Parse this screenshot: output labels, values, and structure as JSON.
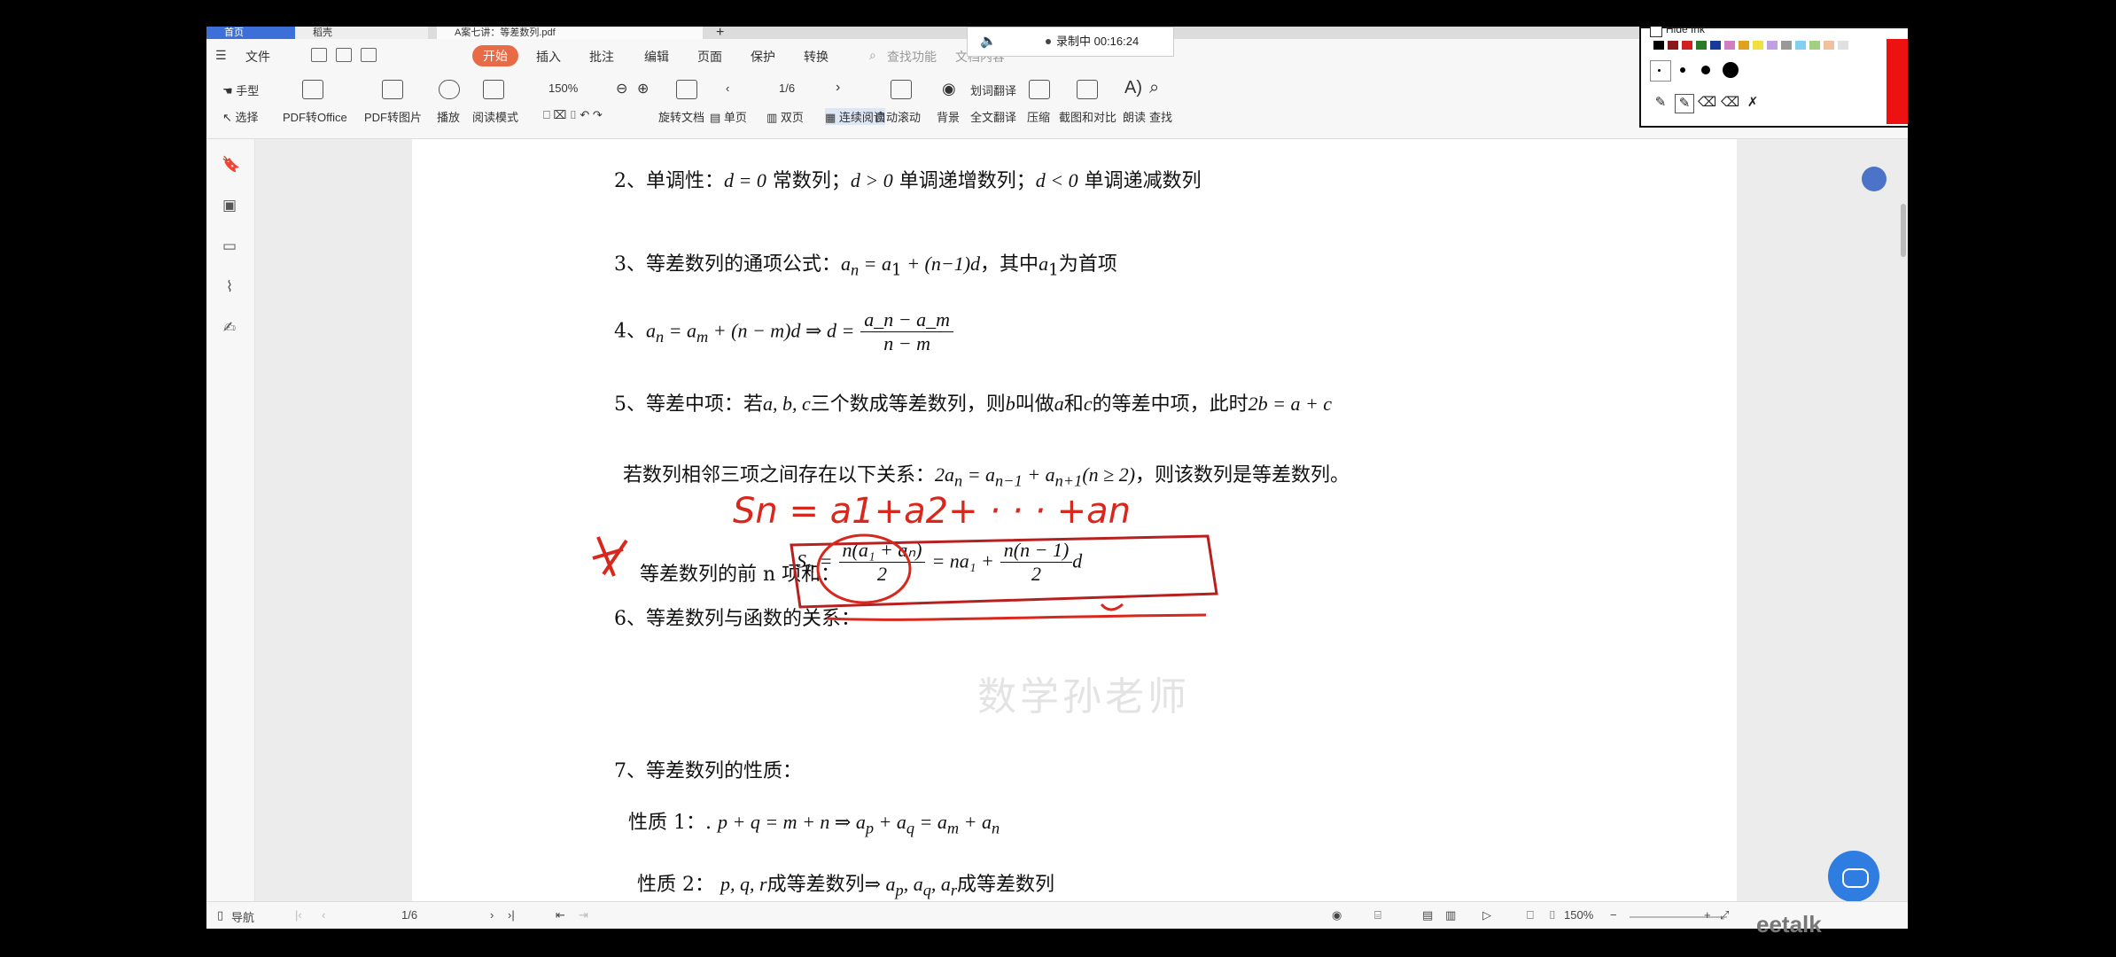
{
  "tabs": {
    "home": "首页",
    "second": "稻壳",
    "doc": "A案七讲：等差数列.pdf"
  },
  "menu": {
    "file": "文件",
    "start": "开始",
    "insert": "插入",
    "annotate": "批注",
    "edit": "编辑",
    "page": "页面",
    "protect": "保护",
    "convert": "转换",
    "search_placeholder": "查找功能",
    "doc_content": "文档内容"
  },
  "recording": {
    "text": "录制中 00:16:24"
  },
  "ink": {
    "hide_label": "Hide Ink"
  },
  "toolbar": {
    "hand": "手型",
    "select": "选择",
    "pdf_office": "PDF转Office",
    "pdf_image": "PDF转图片",
    "play": "播放",
    "read_mode": "阅读模式",
    "zoom": "150%",
    "page": "1/6",
    "rotate": "旋转文档",
    "single": "单页",
    "double": "双页",
    "continuous": "连续阅读",
    "autoscroll": "自动滚动",
    "background": "背景",
    "word_translate": "划词翻译",
    "full_translate": "全文翻译",
    "compress": "压缩",
    "compare": "截图和对比",
    "read_aloud": "朗读",
    "find": "查找"
  },
  "doc": {
    "l2_a": "2、单调性：",
    "l2_b": "d = 0",
    "l2_c": "常数列；",
    "l2_d": "d > 0",
    "l2_e": "单调递增数列；",
    "l2_f": "d < 0",
    "l2_g": "单调递减数列",
    "l3_a": "3、等差数列的通项公式：",
    "l3_b": "a",
    "l3_c": "n",
    "l3_d": " = a",
    "l3_e": "1",
    "l3_f": " + (n−1)d",
    "l3_g": "，其中",
    "l3_h": "a",
    "l3_i": "1",
    "l3_j": "为首项",
    "l4_a": "4、",
    "l4_b": "a",
    "l4_c": "n",
    "l4_d": " = a",
    "l4_e": "m",
    "l4_f": " + (n − m)d ⇒ d =",
    "l4_num": "a_n − a_m",
    "l4_den": "n − m",
    "l5_a": "5、等差中项：若",
    "l5_b": "a, b, c",
    "l5_c": "三个数成等差数列，则",
    "l5_d": "b",
    "l5_e": "叫做",
    "l5_f": "a",
    "l5_g": "和",
    "l5_h": "c",
    "l5_i": "的等差中项，此时",
    "l5_j": "2b = a + c",
    "l5b_a": "若数列相邻三项之间存在以下关系：",
    "l5b_b": "2a",
    "l5b_c": "n",
    "l5b_d": " = a",
    "l5b_e": "n−1",
    "l5b_f": " + a",
    "l5b_g": "n+1",
    "l5b_h": "(n ≥ 2)",
    "l5b_i": "，则该数列是等差数列。",
    "sum_label": "等差数列的前 n 项和：",
    "sum_s": "S",
    "sum_n": "n",
    "sum_eq": " =",
    "sum_num1": "n(a₁ + aₙ)",
    "sum_den1": "2",
    "sum_mid": "= na₁ +",
    "sum_num2": "n(n − 1)",
    "sum_den2": "2",
    "sum_d": "d",
    "l6": "6、等差数列与函数的关系：",
    "watermark": "数学孙老师",
    "l7": "7、等差数列的性质：",
    "p1_a": "性质 1：.",
    "p1_b": "p + q = m + n ⇒ a",
    "p1_c": "p",
    "p1_d": " + a",
    "p1_e": "q",
    "p1_f": " = a",
    "p1_g": "m",
    "p1_h": " + a",
    "p1_i": "n",
    "p2_a": "性质 2：",
    "p2_b": "p, q, r",
    "p2_c": "成等差数列",
    "p2_d": "⇒ a",
    "p2_e": "p",
    "p2_f": ", a",
    "p2_g": "q",
    "p2_h": ", a",
    "p2_i": "r",
    "p2_j": "成等差数列"
  },
  "handwriting": {
    "sum_formula": "Sn = a1+a2+ · · · +an"
  },
  "status": {
    "nav": "导航",
    "page": "1/6",
    "zoom": "150%"
  },
  "brand": {
    "eetalk": "eetalk"
  },
  "colors": {
    "start_tab": "#e86b48",
    "ink_red": "#d8281e",
    "fab_blue": "#2f7de1",
    "home_tab": "#3d6fd8"
  }
}
